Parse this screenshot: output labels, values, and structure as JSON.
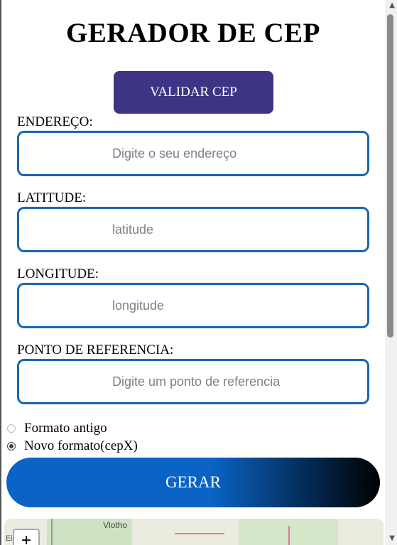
{
  "page": {
    "title": "GERADOR DE CEP",
    "validate_label": "VALIDAR CEP"
  },
  "fields": [
    {
      "label": "ENDEREÇO:",
      "placeholder": "Digite o seu endereço"
    },
    {
      "label": "LATITUDE:",
      "placeholder": "latitude"
    },
    {
      "label": "LONGITUDE:",
      "placeholder": "longitude"
    },
    {
      "label": "PONTO DE REFERENCIA:",
      "placeholder": "Digite um ponto de referencia"
    }
  ],
  "format_options": [
    {
      "label": "Formato antigo",
      "checked": false
    },
    {
      "label": "Novo formato(cepX)",
      "checked": true
    }
  ],
  "generate_label": "GERAR",
  "map": {
    "city_label": "Vlotho",
    "zoom_in_label": "+",
    "corner_label": "Ei"
  },
  "colors": {
    "validate_button": "#3d3485",
    "input_border": "#1a66b3",
    "generate_gradient_start": "#0a63c5",
    "generate_gradient_end": "#000000"
  },
  "icons": {
    "scroll_up": "triangle-up-icon",
    "scroll_down": "triangle-down-icon"
  }
}
